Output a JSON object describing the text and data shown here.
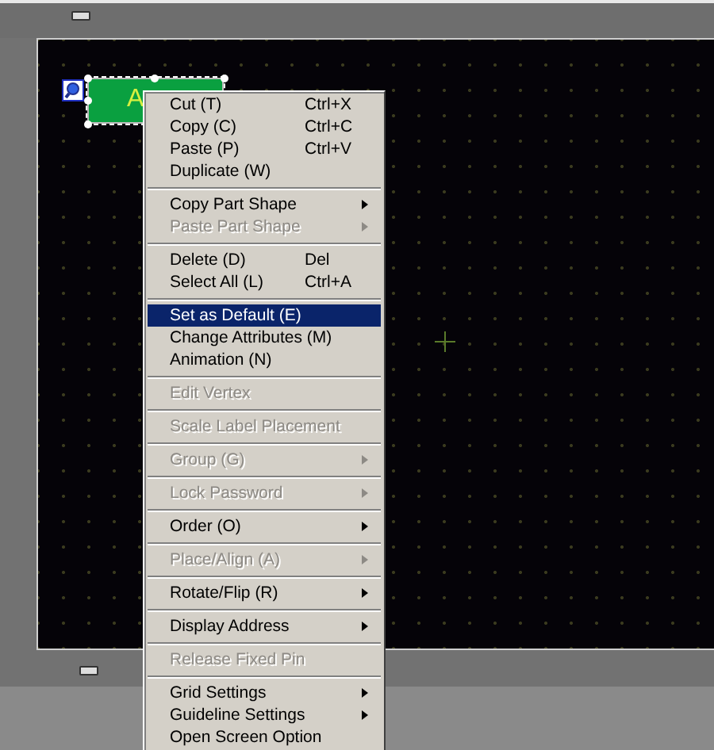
{
  "part": {
    "label": "A",
    "selected": true
  },
  "context_menu": {
    "items": [
      {
        "kind": "item",
        "label": "Cut (T)",
        "shortcut": "Ctrl+X",
        "submenu": false,
        "disabled": false,
        "selected": false
      },
      {
        "kind": "item",
        "label": "Copy (C)",
        "shortcut": "Ctrl+C",
        "submenu": false,
        "disabled": false,
        "selected": false
      },
      {
        "kind": "item",
        "label": "Paste (P)",
        "shortcut": "Ctrl+V",
        "submenu": false,
        "disabled": false,
        "selected": false
      },
      {
        "kind": "item",
        "label": "Duplicate (W)",
        "submenu": false,
        "disabled": false,
        "selected": false
      },
      {
        "kind": "separator"
      },
      {
        "kind": "item",
        "label": "Copy Part Shape",
        "submenu": true,
        "disabled": false,
        "selected": false
      },
      {
        "kind": "item",
        "label": "Paste Part Shape",
        "submenu": true,
        "disabled": true,
        "selected": false
      },
      {
        "kind": "separator"
      },
      {
        "kind": "item",
        "label": "Delete (D)",
        "shortcut": "Del",
        "submenu": false,
        "disabled": false,
        "selected": false
      },
      {
        "kind": "item",
        "label": "Select All (L)",
        "shortcut": "Ctrl+A",
        "submenu": false,
        "disabled": false,
        "selected": false
      },
      {
        "kind": "separator"
      },
      {
        "kind": "item",
        "label": "Set as Default (E)",
        "submenu": false,
        "disabled": false,
        "selected": true
      },
      {
        "kind": "item",
        "label": "Change Attributes (M)",
        "submenu": false,
        "disabled": false,
        "selected": false
      },
      {
        "kind": "item",
        "label": "Animation (N)",
        "submenu": false,
        "disabled": false,
        "selected": false
      },
      {
        "kind": "separator"
      },
      {
        "kind": "item",
        "label": "Edit Vertex",
        "submenu": false,
        "disabled": true,
        "selected": false
      },
      {
        "kind": "separator"
      },
      {
        "kind": "item",
        "label": "Scale Label Placement",
        "submenu": false,
        "disabled": true,
        "selected": false
      },
      {
        "kind": "separator"
      },
      {
        "kind": "item",
        "label": "Group (G)",
        "submenu": true,
        "disabled": true,
        "selected": false
      },
      {
        "kind": "separator"
      },
      {
        "kind": "item",
        "label": "Lock Password",
        "submenu": true,
        "disabled": true,
        "selected": false
      },
      {
        "kind": "separator"
      },
      {
        "kind": "item",
        "label": "Order (O)",
        "submenu": true,
        "disabled": false,
        "selected": false
      },
      {
        "kind": "separator"
      },
      {
        "kind": "item",
        "label": "Place/Align (A)",
        "submenu": true,
        "disabled": true,
        "selected": false
      },
      {
        "kind": "separator"
      },
      {
        "kind": "item",
        "label": "Rotate/Flip (R)",
        "submenu": true,
        "disabled": false,
        "selected": false
      },
      {
        "kind": "separator"
      },
      {
        "kind": "item",
        "label": "Display Address",
        "submenu": true,
        "disabled": false,
        "selected": false
      },
      {
        "kind": "separator"
      },
      {
        "kind": "item",
        "label": "Release Fixed Pin",
        "submenu": false,
        "disabled": true,
        "selected": false
      },
      {
        "kind": "separator"
      },
      {
        "kind": "item",
        "label": "Grid Settings",
        "submenu": true,
        "disabled": false,
        "selected": false
      },
      {
        "kind": "item",
        "label": "Guideline Settings",
        "submenu": true,
        "disabled": false,
        "selected": false
      },
      {
        "kind": "item",
        "label": "Open Screen Option",
        "submenu": false,
        "disabled": false,
        "selected": false
      }
    ]
  }
}
